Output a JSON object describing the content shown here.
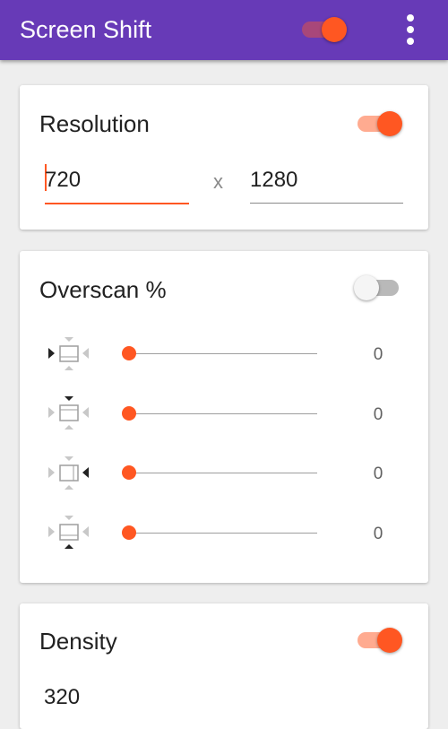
{
  "app_bar": {
    "title": "Screen Shift",
    "master_switch": "on",
    "menu_icon": "overflow-menu-icon"
  },
  "colors": {
    "primary": "#673ab7",
    "accent": "#ff5722",
    "background": "#eeeeee"
  },
  "resolution": {
    "title": "Resolution",
    "switch": "on",
    "width": "720",
    "separator": "x",
    "height": "1280"
  },
  "overscan": {
    "title": "Overscan %",
    "switch": "off",
    "rows": [
      {
        "icon": "overscan-left-icon",
        "value": "0",
        "level": 0
      },
      {
        "icon": "overscan-top-icon",
        "value": "0",
        "level": 0
      },
      {
        "icon": "overscan-right-icon",
        "value": "0",
        "level": 0
      },
      {
        "icon": "overscan-bottom-icon",
        "value": "0",
        "level": 0
      }
    ]
  },
  "density": {
    "title": "Density",
    "switch": "on",
    "value": "320"
  }
}
